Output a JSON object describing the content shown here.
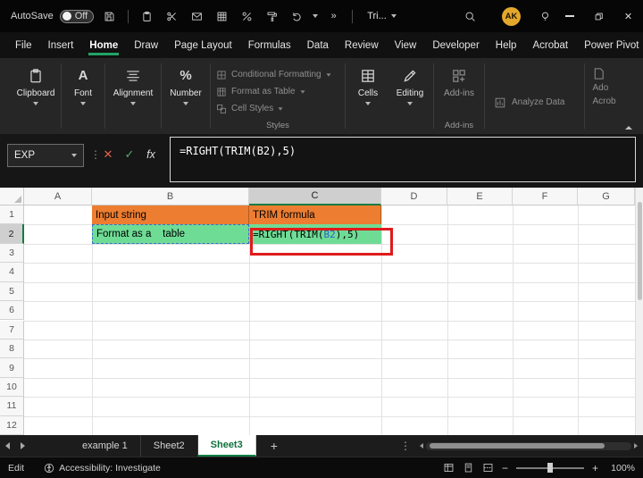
{
  "colors": {
    "excel_green": "#107C41",
    "tab_underline_green": "#21A366",
    "orange_fill": "#ED7D31",
    "green_fill": "#6FDC96",
    "annotation_red": "#E01B1B",
    "reference_blue": "#2B5FC7",
    "avatar_gold": "#E3A82B"
  },
  "titlebar": {
    "autosave_label": "AutoSave",
    "autosave_state": "Off",
    "overflow_glyph": "»",
    "workbook_menu_label": "Tri...",
    "avatar_initials": "AK",
    "close_glyph": "✕"
  },
  "ribbon_tabs": [
    {
      "label": "File",
      "active": false
    },
    {
      "label": "Insert",
      "active": false
    },
    {
      "label": "Home",
      "active": true
    },
    {
      "label": "Draw",
      "active": false
    },
    {
      "label": "Page Layout",
      "active": false
    },
    {
      "label": "Formulas",
      "active": false
    },
    {
      "label": "Data",
      "active": false
    },
    {
      "label": "Review",
      "active": false
    },
    {
      "label": "View",
      "active": false
    },
    {
      "label": "Developer",
      "active": false
    },
    {
      "label": "Help",
      "active": false
    },
    {
      "label": "Acrobat",
      "active": false
    },
    {
      "label": "Power Pivot",
      "active": false
    }
  ],
  "ribbon": {
    "groups": [
      {
        "label": "Clipboard"
      },
      {
        "label": "Font"
      },
      {
        "label": "Alignment"
      },
      {
        "label": "Number"
      }
    ],
    "icons": {
      "font_glyph": "A",
      "number_glyph": "%"
    },
    "styles": {
      "items": [
        {
          "label": "Conditional Formatting"
        },
        {
          "label": "Format as Table"
        },
        {
          "label": "Cell Styles"
        }
      ],
      "group_label": "Styles"
    },
    "cells_label": "Cells",
    "editing_label": "Editing",
    "addins_label": "Add-ins",
    "addins_group_label": "Add-ins",
    "analyze_label": "Analyze Data",
    "acrobat_line1": "Ado",
    "acrobat_line2": "Acrob"
  },
  "formula_bar": {
    "name_box_value": "EXP",
    "separator_glyph": "⋮",
    "cancel_glyph": "✕",
    "enter_glyph": "✓",
    "fx_label": "fx",
    "formula_text": "=RIGHT(TRIM(B2),5)"
  },
  "grid": {
    "columns": [
      "A",
      "B",
      "C",
      "D",
      "E",
      "F",
      "G"
    ],
    "rows": [
      "1",
      "2",
      "3",
      "4",
      "5",
      "6",
      "7",
      "8",
      "9",
      "10",
      "11",
      "12"
    ],
    "selected_column": "C",
    "selected_row": "2",
    "cells": {
      "b1": "Input string",
      "c1": "TRIM formula",
      "b2": "Format as a    table",
      "c2_prefix": "=RIGHT(TRIM(",
      "c2_ref": "B2",
      "c2_suffix": "),5)"
    }
  },
  "sheet_bar": {
    "tabs": [
      {
        "label": "example 1",
        "active": false
      },
      {
        "label": "Sheet2",
        "active": false
      },
      {
        "label": "Sheet3",
        "active": true
      }
    ],
    "add_glyph": "+",
    "more_glyph": "⋮"
  },
  "status_bar": {
    "mode": "Edit",
    "accessibility": "Accessibility: Investigate",
    "zoom_out_glyph": "−",
    "zoom_in_glyph": "+",
    "zoom_value": "100%"
  }
}
